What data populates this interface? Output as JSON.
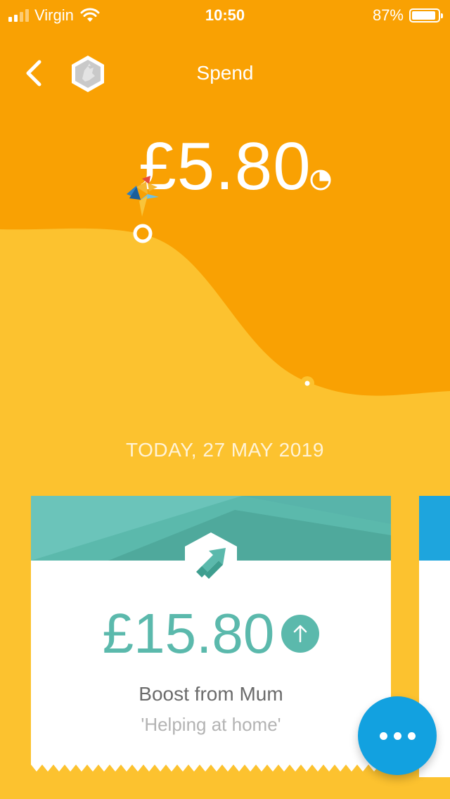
{
  "status_bar": {
    "carrier": "Virgin",
    "time": "10:50",
    "battery_percent": "87%",
    "battery_level": 0.87,
    "icons": [
      "signal-bars-icon",
      "wifi-icon",
      "battery-icon"
    ]
  },
  "header": {
    "title": "Spend",
    "back_icon": "chevron-left-icon",
    "avatar_icon": "rooster-hexagon-icon"
  },
  "balance": {
    "amount": "£5.80",
    "breakdown_icon": "pie-chart-icon"
  },
  "timeline": {
    "date_label": "TODAY, 27 MAY 2019"
  },
  "transaction_card": {
    "amount": "£15.80",
    "direction_icon": "arrow-up-circle-icon",
    "badge_icon": "boost-arrow-icon",
    "title": "Boost from Mum",
    "note": "'Helping at home'"
  },
  "fab": {
    "icon": "more-dots-icon"
  },
  "colors": {
    "header_orange": "#F9A103",
    "body_yellow": "#FCC22F",
    "teal": "#5BB9AC",
    "fab_blue": "#12A1E0",
    "next_card_blue": "#1EA5DD"
  }
}
